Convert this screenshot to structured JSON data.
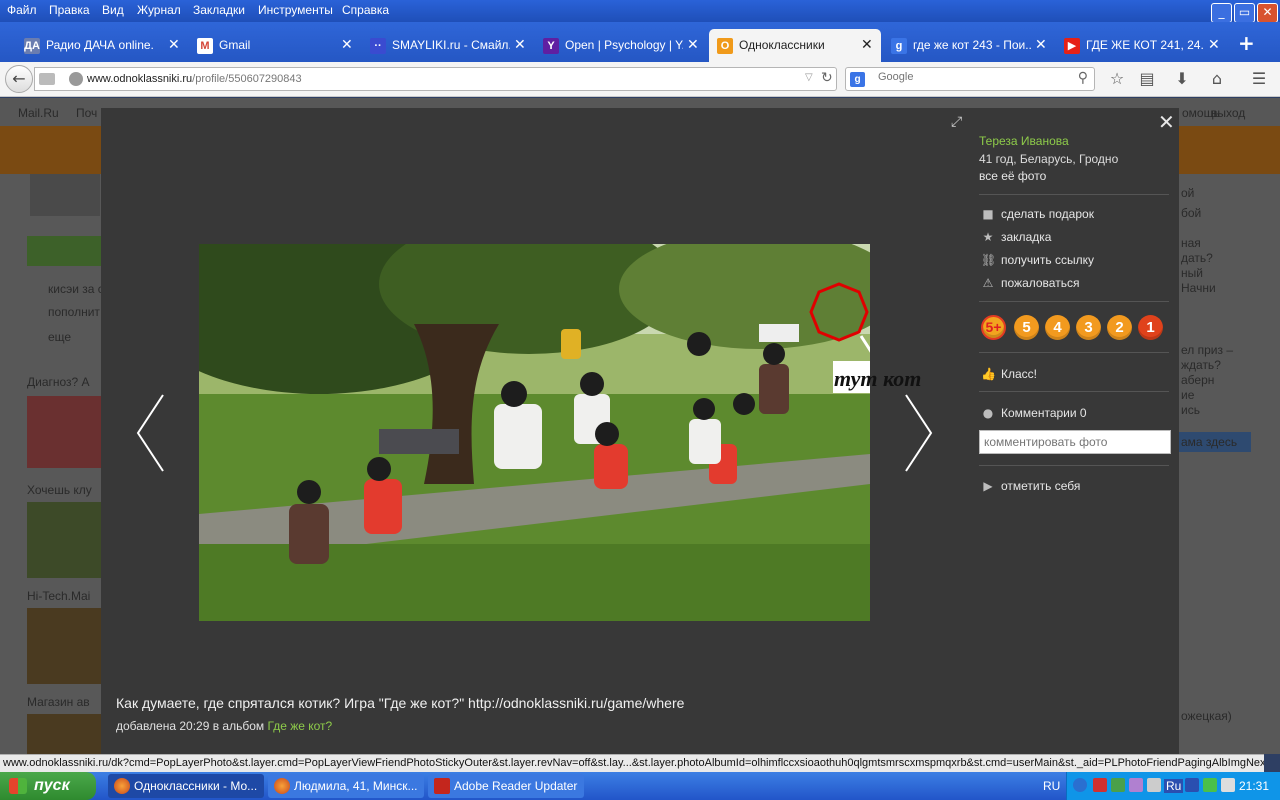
{
  "menubar": {
    "items": [
      "Файл",
      "Правка",
      "Вид",
      "Журнал",
      "Закладки",
      "Инструменты",
      "Справка"
    ]
  },
  "tabs": [
    {
      "label": "Радио ДАЧА online.",
      "icon": "radio-icon",
      "color": "#6a7db0"
    },
    {
      "label": "Gmail",
      "icon": "gmail-icon",
      "color": "#d44638"
    },
    {
      "label": "SMAYLIKI.ru - Смайл...",
      "icon": "smayliki-icon",
      "color": "#3a4bd0"
    },
    {
      "label": "Open | Psychology | Y...",
      "icon": "yahoo-icon",
      "color": "#5f1fa2"
    },
    {
      "label": "Одноклассники",
      "icon": "odnoklassniki-icon",
      "color": "#f09a1b"
    },
    {
      "label": "где же кот 243 - Пои...",
      "icon": "google-icon",
      "color": "#3a74e6"
    },
    {
      "label": "ГДЕ ЖЕ КОТ 241, 24...",
      "icon": "youtube-icon",
      "color": "#e62117"
    }
  ],
  "nav": {
    "url_domain": "www.odnoklassniki.ru",
    "url_path": "/profile/550607290843",
    "search_placeholder": "Google"
  },
  "background_site": {
    "top_links": [
      "Mail.Ru",
      "Поч"
    ],
    "right_links": [
      "омощь",
      "выход"
    ],
    "left_items": [
      "кисэи за с",
      "пополнит",
      "еще",
      "Диагноз? А",
      "Хочешь клу",
      "Hi-Tech.Mai",
      "Магазин ав"
    ],
    "right_texts": [
      "ой",
      "бой",
      "ная",
      "дать?",
      "ный",
      "Начни",
      "ел приз –",
      "ждать?",
      "аберн",
      "ие",
      "ись",
      "ама здесь",
      "ожецкая)"
    ]
  },
  "viewer": {
    "owner_name": "Тереза Иванова",
    "owner_info": "41 год, Беларусь, Гродно",
    "all_photos": "все её фото",
    "actions": [
      {
        "label": "сделать подарок",
        "icon": "gift-icon"
      },
      {
        "label": "закладка",
        "icon": "star-icon"
      },
      {
        "label": "получить ссылку",
        "icon": "link-icon"
      },
      {
        "label": "пожаловаться",
        "icon": "warning-icon"
      }
    ],
    "ratings": [
      "5+",
      "5",
      "4",
      "3",
      "2",
      "1"
    ],
    "klass_label": "Класс!",
    "comments_label": "Комментарии 0",
    "comment_placeholder": "комментировать фото",
    "tag_self_label": "отметить себя",
    "photo_annotation": "тут кот",
    "caption": "Как думаете, где спрятался котик? Игра \"Где же кот?\" http://odnoklassniki.ru/game/where",
    "added_prefix": "добавлена 20:29 в альбом",
    "album_link": "Где же кот?"
  },
  "statusbar": {
    "text": "www.odnoklassniki.ru/dk?cmd=PopLayerPhoto&st.layer.cmd=PopLayerViewFriendPhotoStickyOuter&st.layer.revNav=off&st.lay...&st.layer.photoAlbumId=olhimflccxsioaothuh0qlgmtsmrscxmspmqxrb&st.cmd=userMain&st._aid=PLPhotoFriendPagingAlbImgNext"
  },
  "taskbar": {
    "start_label": "пуск",
    "tasks": [
      {
        "label": "Одноклассники - Мо...",
        "icon": "firefox-icon",
        "active": true
      },
      {
        "label": "Людмила, 41, Минск...",
        "icon": "firefox-icon",
        "active": false
      },
      {
        "label": "Adobe Reader Updater",
        "icon": "adobe-reader-icon",
        "active": false
      }
    ],
    "language": "RU",
    "tray_lang": "Ru",
    "clock": "21:31"
  }
}
